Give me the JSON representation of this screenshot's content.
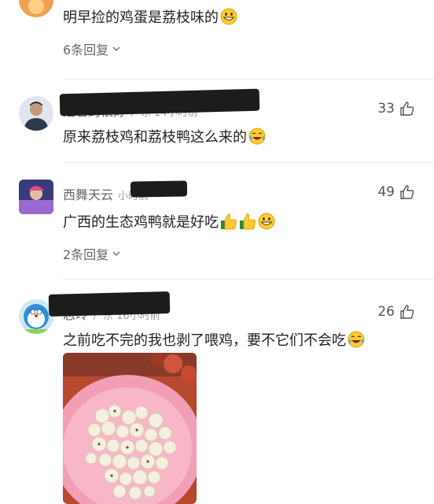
{
  "comments": [
    {
      "username": "",
      "meta": "",
      "likes": "",
      "text": "明早捡的鸡蛋是荔枝味的",
      "replies": "6条回复"
    },
    {
      "username": "活着的很好",
      "meta": "广东 14小时前",
      "likes": "33",
      "text": "原来荔枝鸡和荔枝鸭这么来的",
      "replies": ""
    },
    {
      "username": "西舞天云",
      "meta": "小时前",
      "likes": "49",
      "text": "广西的生态鸡鸭就是好吃",
      "replies": "2条回复"
    },
    {
      "username": "志玲",
      "meta": "广东 16小时前",
      "likes": "26",
      "text": "之前吃不完的我也剥了喂鸡，要不它们不会吃",
      "replies": ""
    }
  ],
  "icons": {
    "thumb": "thumbs-up-outline-icon",
    "grin": "grinning-emoji",
    "laugh": "laughing-tears-emoji",
    "thumbs_up_emoji": "thumbs-up-emoji",
    "chevron": "chevron-down-icon"
  },
  "colors": {
    "text": "#222222",
    "muted": "#666666",
    "divider": "#ececec"
  }
}
